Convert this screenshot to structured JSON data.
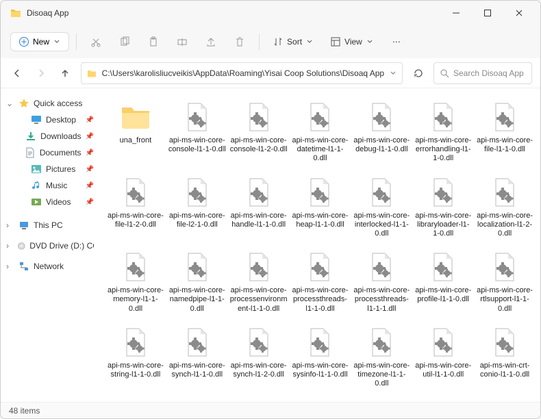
{
  "window": {
    "title": "Disoaq App"
  },
  "toolbar": {
    "new": "New",
    "sort": "Sort",
    "view": "View"
  },
  "nav": {
    "path": "C:\\Users\\karolisliucveikis\\AppData\\Roaming\\Yisai Coop Solutions\\Disoaq App",
    "searchPlaceholder": "Search Disoaq App"
  },
  "sidebar": {
    "quick": "Quick access",
    "items": [
      {
        "label": "Desktop",
        "icon": "desktop"
      },
      {
        "label": "Downloads",
        "icon": "download"
      },
      {
        "label": "Documents",
        "icon": "doc"
      },
      {
        "label": "Pictures",
        "icon": "pic"
      },
      {
        "label": "Music",
        "icon": "music"
      },
      {
        "label": "Videos",
        "icon": "video"
      }
    ],
    "pc": "This PC",
    "dvd": "DVD Drive (D:) CCCC",
    "net": "Network"
  },
  "files": [
    {
      "name": "una_front",
      "type": "folder"
    },
    {
      "name": "api-ms-win-core-console-l1-1-0.dll",
      "type": "dll"
    },
    {
      "name": "api-ms-win-core-console-l1-2-0.dll",
      "type": "dll"
    },
    {
      "name": "api-ms-win-core-datetime-l1-1-0.dll",
      "type": "dll"
    },
    {
      "name": "api-ms-win-core-debug-l1-1-0.dll",
      "type": "dll"
    },
    {
      "name": "api-ms-win-core-errorhandling-l1-1-0.dll",
      "type": "dll"
    },
    {
      "name": "api-ms-win-core-file-l1-1-0.dll",
      "type": "dll"
    },
    {
      "name": "api-ms-win-core-file-l1-2-0.dll",
      "type": "dll"
    },
    {
      "name": "api-ms-win-core-file-l2-1-0.dll",
      "type": "dll"
    },
    {
      "name": "api-ms-win-core-handle-l1-1-0.dll",
      "type": "dll"
    },
    {
      "name": "api-ms-win-core-heap-l1-1-0.dll",
      "type": "dll"
    },
    {
      "name": "api-ms-win-core-interlocked-l1-1-0.dll",
      "type": "dll"
    },
    {
      "name": "api-ms-win-core-libraryloader-l1-1-0.dll",
      "type": "dll"
    },
    {
      "name": "api-ms-win-core-localization-l1-2-0.dll",
      "type": "dll"
    },
    {
      "name": "api-ms-win-core-memory-l1-1-0.dll",
      "type": "dll"
    },
    {
      "name": "api-ms-win-core-namedpipe-l1-1-0.dll",
      "type": "dll"
    },
    {
      "name": "api-ms-win-core-processenvironment-l1-1-0.dll",
      "type": "dll"
    },
    {
      "name": "api-ms-win-core-processthreads-l1-1-0.dll",
      "type": "dll"
    },
    {
      "name": "api-ms-win-core-processthreads-l1-1-1.dll",
      "type": "dll"
    },
    {
      "name": "api-ms-win-core-profile-l1-1-0.dll",
      "type": "dll"
    },
    {
      "name": "api-ms-win-core-rtlsupport-l1-1-0.dll",
      "type": "dll"
    },
    {
      "name": "api-ms-win-core-string-l1-1-0.dll",
      "type": "dll"
    },
    {
      "name": "api-ms-win-core-synch-l1-1-0.dll",
      "type": "dll"
    },
    {
      "name": "api-ms-win-core-synch-l1-2-0.dll",
      "type": "dll"
    },
    {
      "name": "api-ms-win-core-sysinfo-l1-1-0.dll",
      "type": "dll"
    },
    {
      "name": "api-ms-win-core-timezone-l1-1-0.dll",
      "type": "dll"
    },
    {
      "name": "api-ms-win-core-util-l1-1-0.dll",
      "type": "dll"
    },
    {
      "name": "api-ms-win-crt-conio-l1-1-0.dll",
      "type": "dll"
    }
  ],
  "status": {
    "count": "48 items"
  }
}
